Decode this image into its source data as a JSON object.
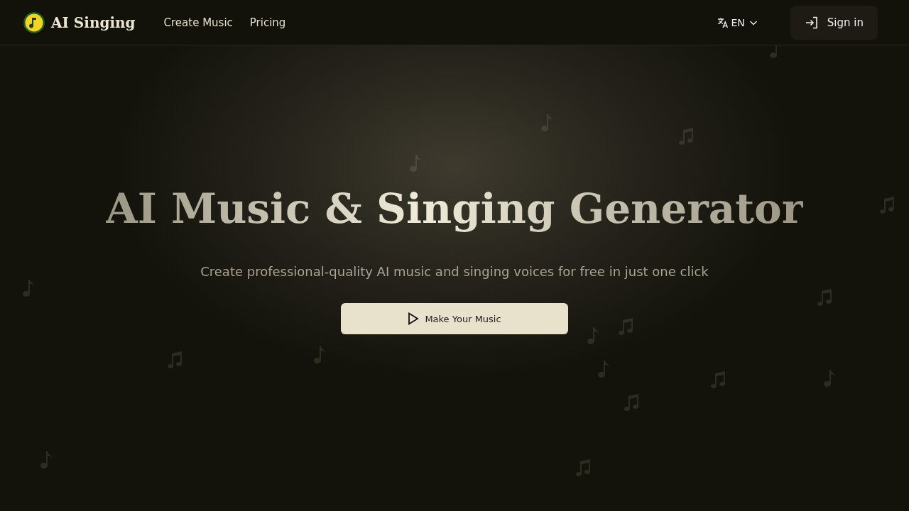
{
  "header": {
    "brand": "AI Singing",
    "nav": [
      {
        "label": "Create Music"
      },
      {
        "label": "Pricing"
      }
    ],
    "language": "EN",
    "sign_in": "Sign in"
  },
  "hero": {
    "title": "AI Music & Singing Generator",
    "subtitle": "Create professional-quality AI music and singing voices for free in just one click",
    "cta": "Make Your Music"
  }
}
